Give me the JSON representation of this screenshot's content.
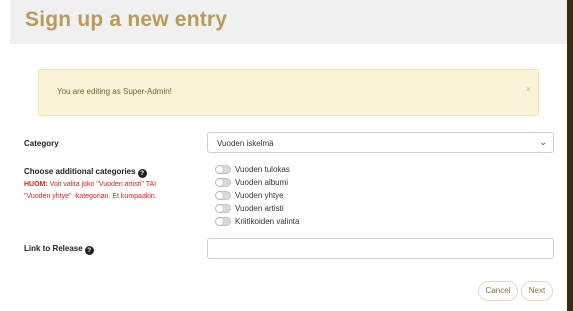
{
  "header": {
    "title": "Sign up a new entry"
  },
  "alert": {
    "message": "You are editing as Super-Admin!",
    "close_label": "×"
  },
  "form": {
    "category": {
      "label": "Category",
      "selected": "Vuoden iskelmä",
      "chevron_icon": "chevron-down-icon"
    },
    "additional": {
      "label": "Choose additional categories",
      "help_icon": "?",
      "warning_prefix": "HUOM:",
      "warning_text": " Voit valita joko \"Vuoden artisti\" TAI \"Vuoden yhtye\" -kategorian. Et kumpaakin.",
      "toggles": [
        {
          "label": "Vuoden tulokas",
          "on": false
        },
        {
          "label": "Vuoden albumi",
          "on": false
        },
        {
          "label": "Vuoden yhtye",
          "on": false
        },
        {
          "label": "Vuoden artisti",
          "on": false
        },
        {
          "label": "Kriitikoiden valinta",
          "on": false
        }
      ]
    },
    "link": {
      "label": "Link to Release",
      "help_icon": "?",
      "value": ""
    }
  },
  "actions": {
    "cancel_label": "Cancel",
    "next_label": "Next"
  },
  "colors": {
    "accent": "#b89a5a",
    "warning": "#e02020",
    "alert_bg": "#fbf3d8"
  }
}
